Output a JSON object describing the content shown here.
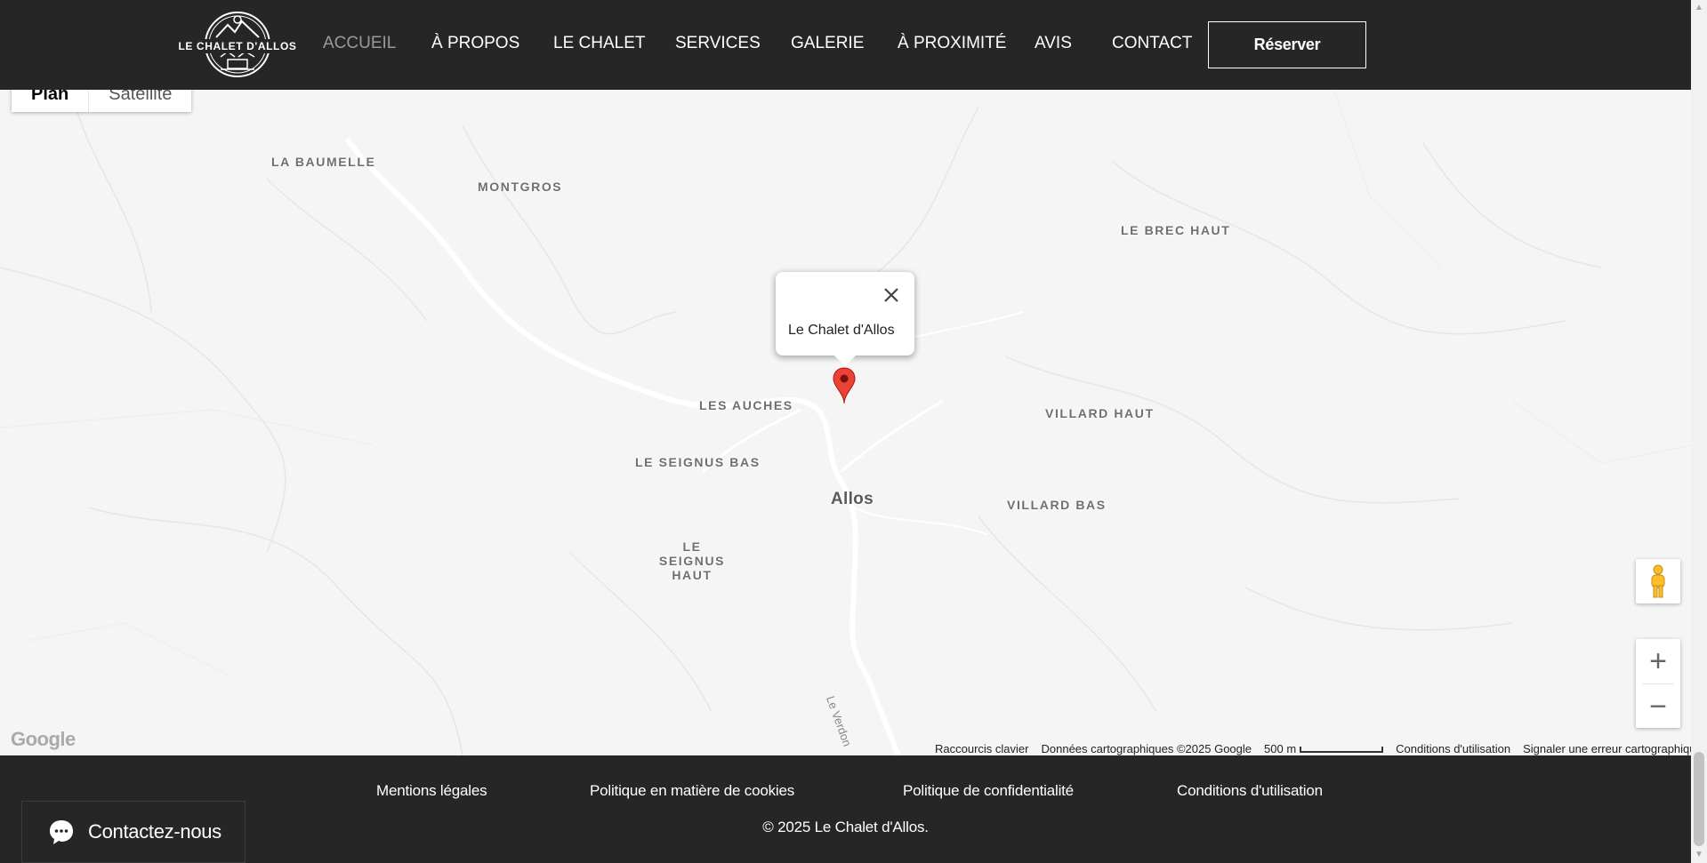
{
  "header": {
    "logo_text": "LE CHALET D'ALLOS",
    "nav": [
      {
        "label": "ACCUEIL",
        "active": true
      },
      {
        "label": "À PROPOS",
        "active": false
      },
      {
        "label": "LE CHALET",
        "active": false
      },
      {
        "label": "SERVICES",
        "active": false
      },
      {
        "label": "GALERIE",
        "active": false
      },
      {
        "label": "À PROXIMITÉ",
        "active": false
      },
      {
        "label": "AVIS",
        "active": false
      },
      {
        "label": "CONTACT",
        "active": false
      }
    ],
    "reserve_label": "Réserver"
  },
  "map": {
    "type_controls": {
      "map": "Plan",
      "satellite": "Satellite"
    },
    "places": [
      {
        "name": "LA BAUMELLE"
      },
      {
        "name": "MONTGROS"
      },
      {
        "name": "LE BREC HAUT"
      },
      {
        "name": "LES AUCHES"
      },
      {
        "name": "VILLARD HAUT"
      },
      {
        "name": "LE SEIGNUS BAS"
      },
      {
        "name": "Allos"
      },
      {
        "name": "VILLARD BAS"
      },
      {
        "name": "LE SEIGNUS HAUT"
      }
    ],
    "river": "Le Verdon",
    "infowindow_title": "Le Chalet d'Allos",
    "zoom_in": "+",
    "zoom_out": "−",
    "google_logo": "Google",
    "attribution": {
      "shortcuts": "Raccourcis clavier",
      "data": "Données cartographiques ©2025 Google",
      "scale": "500 m",
      "terms": "Conditions d'utilisation",
      "report": "Signaler une erreur cartographique"
    },
    "icons": {
      "pin": "map-pin-icon",
      "close": "close-icon",
      "pegman": "pegman-icon"
    },
    "colors": {
      "pin": "#ea4335",
      "land": "#f5f5f5",
      "road": "#ffffff"
    }
  },
  "footer": {
    "links": [
      "Mentions légales",
      "Politique en matière de cookies",
      "Politique de confidentialité",
      "Conditions d'utilisation"
    ],
    "copyright": "© 2025 Le Chalet d'Allos.",
    "contact_button": "Contactez-nous"
  },
  "colors": {
    "header_bg": "#262626",
    "footer_bg": "#262626",
    "nav_active": "#9a9a9a",
    "text": "#ffffff"
  }
}
